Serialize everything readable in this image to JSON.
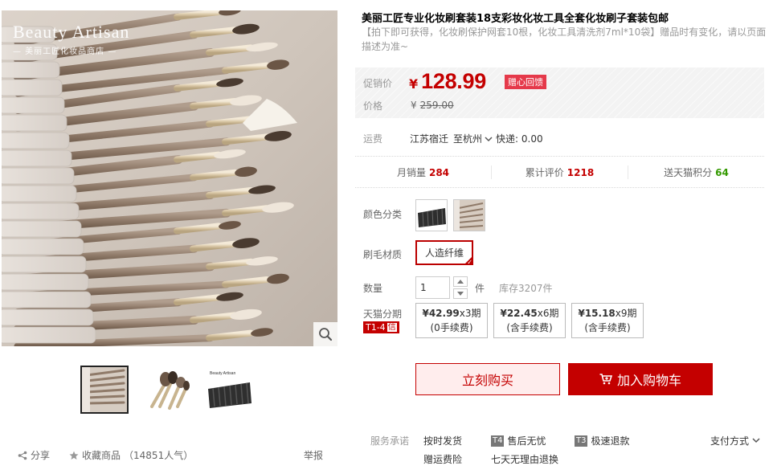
{
  "gallery": {
    "watermark_title": "Beauty Artisan",
    "watermark_sub": "— 美丽工匠化妆品商店 —",
    "thumbs": [
      "thumb-brushes-roll",
      "thumb-brushes-closeup",
      "thumb-brushes-case"
    ]
  },
  "left_footer": {
    "share_label": "分享",
    "fav_label": "收藏商品",
    "fav_count": "（14851人气）",
    "report_label": "举报"
  },
  "product": {
    "title": "美丽工匠专业化妆刷套装18支彩妆化妆工具全套化妆刷子套装包邮",
    "subtitle": "【拍下即可获得，化妆刷保护网套10根，化妆工具清洗剂7ml*10袋】赠品时有变化，请以页面描述为准~"
  },
  "price": {
    "promo_label": "促销价",
    "currency": "¥",
    "promo_value": "128.99",
    "promo_badge": "赠心回馈",
    "orig_label": "价格",
    "orig_currency": "¥",
    "orig_value": "259.00"
  },
  "shipping": {
    "label": "运费",
    "from": "江苏宿迁",
    "to": "至杭州",
    "method": "快递: 0.00"
  },
  "stats": {
    "monthly_label": "月销量",
    "monthly_value": "284",
    "reviews_label": "累计评价",
    "reviews_value": "1218",
    "points_label": "送天猫积分",
    "points_value": "64"
  },
  "options": {
    "color_label": "颜色分类",
    "material_label": "刷毛材质",
    "material_value": "人造纤维",
    "qty_label": "数量",
    "qty_value": "1",
    "qty_unit": "件",
    "stock": "库存3207件"
  },
  "installment": {
    "label": "天猫分期",
    "badge": "T1-4",
    "badge_xin": "信",
    "plans": [
      {
        "amount": "¥42.99",
        "periods": "x3期",
        "fee": "(0手续费)"
      },
      {
        "amount": "¥22.45",
        "periods": "x6期",
        "fee": "(含手续费)"
      },
      {
        "amount": "¥15.18",
        "periods": "x9期",
        "fee": "(含手续费)"
      }
    ]
  },
  "actions": {
    "buy_now": "立刻购买",
    "add_cart": "加入购物车"
  },
  "service": {
    "label": "服务承诺",
    "items": [
      "按时发货",
      "售后无忧",
      "极速退款",
      "赠运费险",
      "七天无理由退换"
    ],
    "tag_t4": "T4",
    "tag_t3": "T3",
    "pay_label": "支付方式"
  },
  "colors": {
    "accent": "#c40000",
    "buy_bg": "#ffeded",
    "promo_badge": "#e5394a"
  }
}
